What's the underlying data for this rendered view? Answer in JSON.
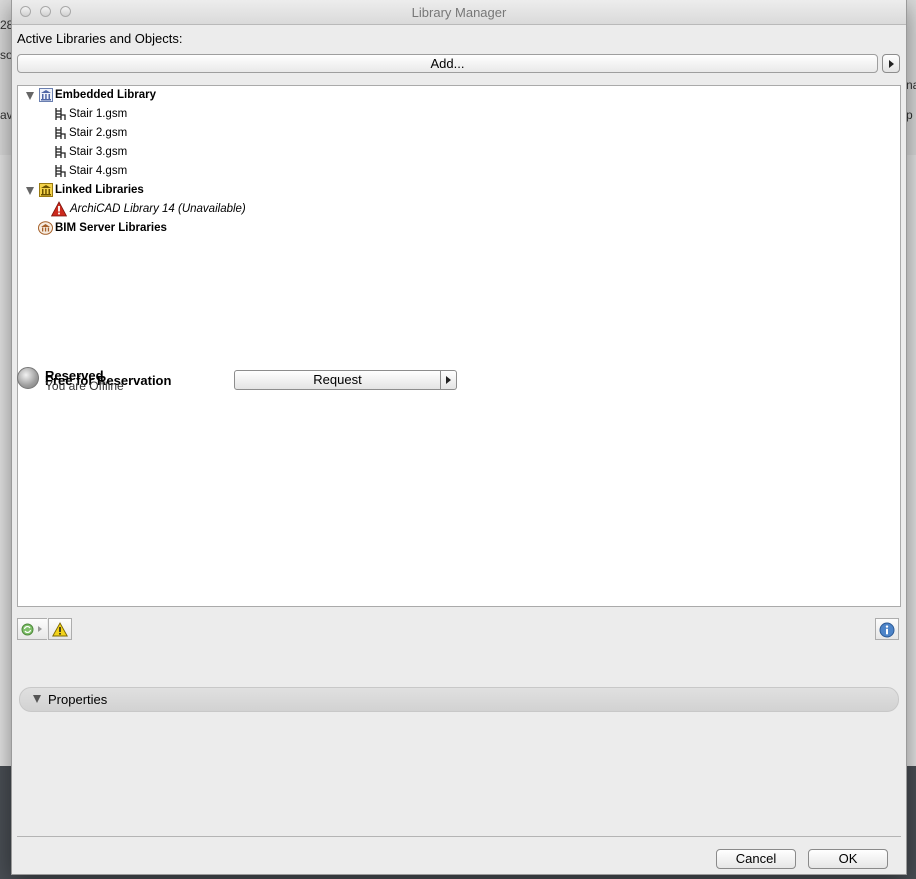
{
  "window": {
    "title": "Library Manager"
  },
  "background_fragments": {
    "left_top": "28",
    "left_mid": "so",
    "left_low": "av",
    "right_mid": "na",
    "right_low": "p"
  },
  "libraries": {
    "section_label": "Active Libraries and Objects:",
    "add_button_label": "Add...",
    "tree": [
      {
        "kind": "group",
        "label": "Embedded Library",
        "expanded": true,
        "icon": "embedded-library-icon"
      },
      {
        "kind": "object",
        "label": "Stair 1.gsm",
        "icon": "stair-object-icon"
      },
      {
        "kind": "object",
        "label": "Stair 2.gsm",
        "icon": "stair-object-icon"
      },
      {
        "kind": "object",
        "label": "Stair 3.gsm",
        "icon": "stair-object-icon"
      },
      {
        "kind": "object",
        "label": "Stair 4.gsm",
        "icon": "stair-object-icon"
      },
      {
        "kind": "group",
        "label": "Linked Libraries",
        "expanded": true,
        "icon": "linked-library-icon"
      },
      {
        "kind": "missing",
        "label": "ArchiCAD Library 14 (Unavailable)",
        "icon": "warning-icon"
      },
      {
        "kind": "group",
        "label": "BIM Server Libraries",
        "expanded": false,
        "icon": "bim-server-library-icon"
      }
    ]
  },
  "reservation": {
    "status_reserved": "Reserved",
    "status_free": "Free for Reservation",
    "status_offline": "You are Offline",
    "request_button_label": "Request"
  },
  "properties": {
    "label": "Properties"
  },
  "dialog_buttons": {
    "cancel_label": "Cancel",
    "ok_label": "OK"
  },
  "colors": {
    "warning": "#f2d21a",
    "error_red": "#cc2a1e",
    "info_blue": "#4d84c8",
    "sync_green": "#7fc06a"
  }
}
